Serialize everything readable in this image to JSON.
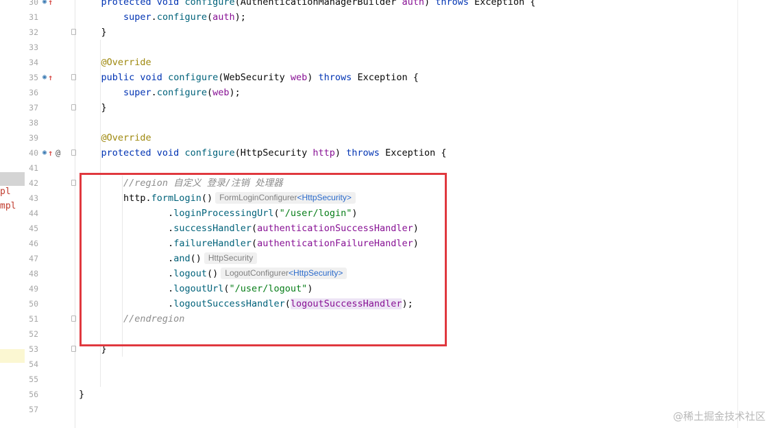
{
  "left_fragments": [
    "pl",
    "mpl"
  ],
  "gutter": [
    {
      "n": "30",
      "impl": true,
      "up": true
    },
    {
      "n": "31"
    },
    {
      "n": "32",
      "fold": true
    },
    {
      "n": "33"
    },
    {
      "n": "34"
    },
    {
      "n": "35",
      "impl": true,
      "up": true,
      "fold": true
    },
    {
      "n": "36"
    },
    {
      "n": "37",
      "fold": true
    },
    {
      "n": "38"
    },
    {
      "n": "39"
    },
    {
      "n": "40",
      "impl": true,
      "up": true,
      "at": true,
      "fold": true
    },
    {
      "n": "41"
    },
    {
      "n": "42",
      "fold": true
    },
    {
      "n": "43"
    },
    {
      "n": "44"
    },
    {
      "n": "45"
    },
    {
      "n": "46"
    },
    {
      "n": "47"
    },
    {
      "n": "48"
    },
    {
      "n": "49"
    },
    {
      "n": "50"
    },
    {
      "n": "51",
      "fold": true
    },
    {
      "n": "52"
    },
    {
      "n": "53",
      "fold": true
    },
    {
      "n": "54"
    },
    {
      "n": "55"
    },
    {
      "n": "56"
    },
    {
      "n": "57"
    }
  ],
  "code": [
    {
      "indent": 4,
      "tokens": [
        {
          "t": "protected void ",
          "c": "kw"
        },
        {
          "t": "configure",
          "c": "fn"
        },
        {
          "t": "(AuthenticationManagerBuilder "
        },
        {
          "t": "auth",
          "c": "par"
        },
        {
          "t": ") "
        },
        {
          "t": "throws",
          "c": "kw"
        },
        {
          "t": " Exception {"
        }
      ]
    },
    {
      "indent": 8,
      "tokens": [
        {
          "t": "super",
          "c": "kw"
        },
        {
          "t": "."
        },
        {
          "t": "configure",
          "c": "fn"
        },
        {
          "t": "("
        },
        {
          "t": "auth",
          "c": "par"
        },
        {
          "t": ");"
        }
      ]
    },
    {
      "indent": 4,
      "tokens": [
        {
          "t": "}"
        }
      ]
    },
    {
      "indent": 0,
      "tokens": []
    },
    {
      "indent": 4,
      "tokens": [
        {
          "t": "@Override",
          "c": "ann"
        }
      ]
    },
    {
      "indent": 4,
      "tokens": [
        {
          "t": "public void ",
          "c": "kw"
        },
        {
          "t": "configure",
          "c": "fn"
        },
        {
          "t": "(WebSecurity "
        },
        {
          "t": "web",
          "c": "par"
        },
        {
          "t": ") "
        },
        {
          "t": "throws",
          "c": "kw"
        },
        {
          "t": " Exception {"
        }
      ]
    },
    {
      "indent": 8,
      "tokens": [
        {
          "t": "super",
          "c": "kw"
        },
        {
          "t": "."
        },
        {
          "t": "configure",
          "c": "fn"
        },
        {
          "t": "("
        },
        {
          "t": "web",
          "c": "par"
        },
        {
          "t": ");"
        }
      ]
    },
    {
      "indent": 4,
      "tokens": [
        {
          "t": "}"
        }
      ]
    },
    {
      "indent": 0,
      "tokens": []
    },
    {
      "indent": 4,
      "tokens": [
        {
          "t": "@Override",
          "c": "ann"
        }
      ]
    },
    {
      "indent": 4,
      "tokens": [
        {
          "t": "protected void ",
          "c": "kw"
        },
        {
          "t": "configure",
          "c": "fn"
        },
        {
          "t": "(HttpSecurity "
        },
        {
          "t": "http",
          "c": "par"
        },
        {
          "t": ") "
        },
        {
          "t": "throws",
          "c": "kw"
        },
        {
          "t": " Exception {"
        }
      ]
    },
    {
      "indent": 0,
      "tokens": []
    },
    {
      "indent": 8,
      "tokens": [
        {
          "t": "//region 自定义 登录/注销 处理器",
          "c": "cm"
        }
      ]
    },
    {
      "indent": 8,
      "tokens": [
        {
          "t": "http."
        },
        {
          "t": "formLogin",
          "c": "fn"
        },
        {
          "t": "()"
        },
        {
          "hint": "FormLoginConfigurer",
          "ref": "<HttpSecurity>"
        }
      ]
    },
    {
      "indent": 16,
      "tokens": [
        {
          "t": "."
        },
        {
          "t": "loginProcessingUrl",
          "c": "fn"
        },
        {
          "t": "("
        },
        {
          "t": "\"/user/login\"",
          "c": "str"
        },
        {
          "t": ")"
        }
      ]
    },
    {
      "indent": 16,
      "tokens": [
        {
          "t": "."
        },
        {
          "t": "successHandler",
          "c": "fn"
        },
        {
          "t": "("
        },
        {
          "t": "authenticationSuccessHandler",
          "c": "field"
        },
        {
          "t": ")"
        }
      ]
    },
    {
      "indent": 16,
      "tokens": [
        {
          "t": "."
        },
        {
          "t": "failureHandler",
          "c": "fn"
        },
        {
          "t": "("
        },
        {
          "t": "authenticationFailureHandler",
          "c": "field"
        },
        {
          "t": ")"
        }
      ]
    },
    {
      "indent": 16,
      "tokens": [
        {
          "t": "."
        },
        {
          "t": "and",
          "c": "fn"
        },
        {
          "t": "()"
        },
        {
          "hint": "HttpSecurity"
        }
      ]
    },
    {
      "indent": 16,
      "tokens": [
        {
          "t": "."
        },
        {
          "t": "logout",
          "c": "fn"
        },
        {
          "t": "()"
        },
        {
          "hint": "LogoutConfigurer",
          "ref": "<HttpSecurity>"
        }
      ]
    },
    {
      "indent": 16,
      "tokens": [
        {
          "t": "."
        },
        {
          "t": "logoutUrl",
          "c": "fn"
        },
        {
          "t": "("
        },
        {
          "t": "\"/user/logout\"",
          "c": "str"
        },
        {
          "t": ")"
        }
      ]
    },
    {
      "indent": 16,
      "tokens": [
        {
          "t": "."
        },
        {
          "t": "logoutSuccessHandler",
          "c": "fn"
        },
        {
          "t": "("
        },
        {
          "t": "logoutSuccessHandler",
          "c": "field",
          "hl": true
        },
        {
          "t": ");"
        }
      ]
    },
    {
      "indent": 8,
      "tokens": [
        {
          "t": "//endregion",
          "c": "cm"
        }
      ]
    },
    {
      "indent": 0,
      "tokens": []
    },
    {
      "indent": 4,
      "tokens": [
        {
          "t": "}"
        }
      ]
    },
    {
      "indent": 0,
      "tokens": []
    },
    {
      "indent": 0,
      "tokens": []
    },
    {
      "indent": 0,
      "tokens": [
        {
          "t": "}"
        }
      ]
    },
    {
      "indent": 0,
      "tokens": []
    }
  ],
  "watermark": "@稀土掘金技术社区",
  "colors": {
    "keyword": "#0033b3",
    "annotation": "#9e880d",
    "method": "#00627a",
    "string": "#067d17",
    "field": "#871094",
    "comment": "#8c8c8c",
    "highlight_box": "#e0383e"
  }
}
